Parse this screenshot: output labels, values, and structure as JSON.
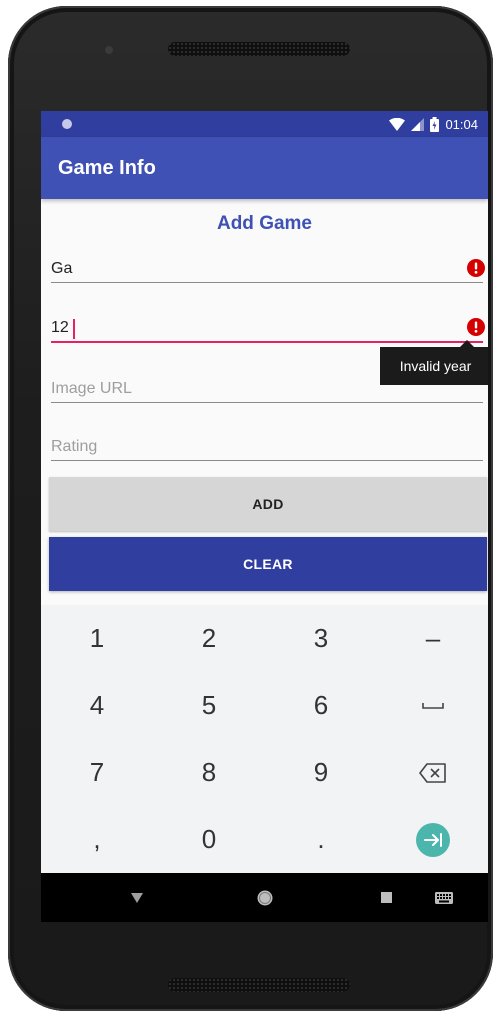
{
  "status_bar": {
    "time": "01:04",
    "icons": [
      "wifi-icon",
      "signal-icon",
      "battery-icon"
    ]
  },
  "app_bar": {
    "title": "Game Info"
  },
  "form": {
    "heading": "Add Game",
    "fields": [
      {
        "value": "Ga",
        "placeholder": "",
        "error": true
      },
      {
        "value": "12",
        "placeholder": "",
        "error": true,
        "focused": true
      },
      {
        "value": "",
        "placeholder": "Image URL",
        "error": false
      },
      {
        "value": "",
        "placeholder": "Rating",
        "error": false
      }
    ],
    "tooltip": "Invalid year",
    "add_label": "ADD",
    "clear_label": "CLEAR"
  },
  "keyboard": {
    "rows": [
      [
        "1",
        "2",
        "3",
        "–"
      ],
      [
        "4",
        "5",
        "6",
        "space"
      ],
      [
        "7",
        "8",
        "9",
        "backspace"
      ],
      [
        ",",
        "0",
        ".",
        "next"
      ]
    ]
  },
  "colors": {
    "primary": "#3f51b5",
    "primary_dark": "#303f9f",
    "accent": "#e91e63",
    "error": "#d50000",
    "next_key": "#4db6ac"
  }
}
